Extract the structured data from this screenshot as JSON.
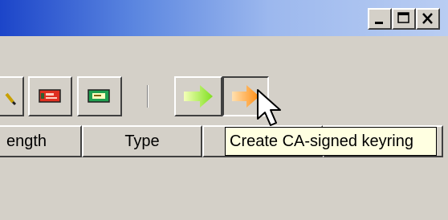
{
  "window": {
    "controls": [
      "minimize",
      "maximize",
      "close"
    ]
  },
  "toolbar": {
    "buttons": [
      {
        "icon": "pen-icon"
      },
      {
        "icon": "red-card-icon"
      },
      {
        "icon": "green-card-icon"
      },
      {
        "icon": "green-arrow-icon"
      },
      {
        "icon": "orange-arrow-icon"
      }
    ]
  },
  "columns": {
    "length_label": "ength",
    "type_label": "Type"
  },
  "tooltip": {
    "text": "Create CA-signed keyring"
  }
}
